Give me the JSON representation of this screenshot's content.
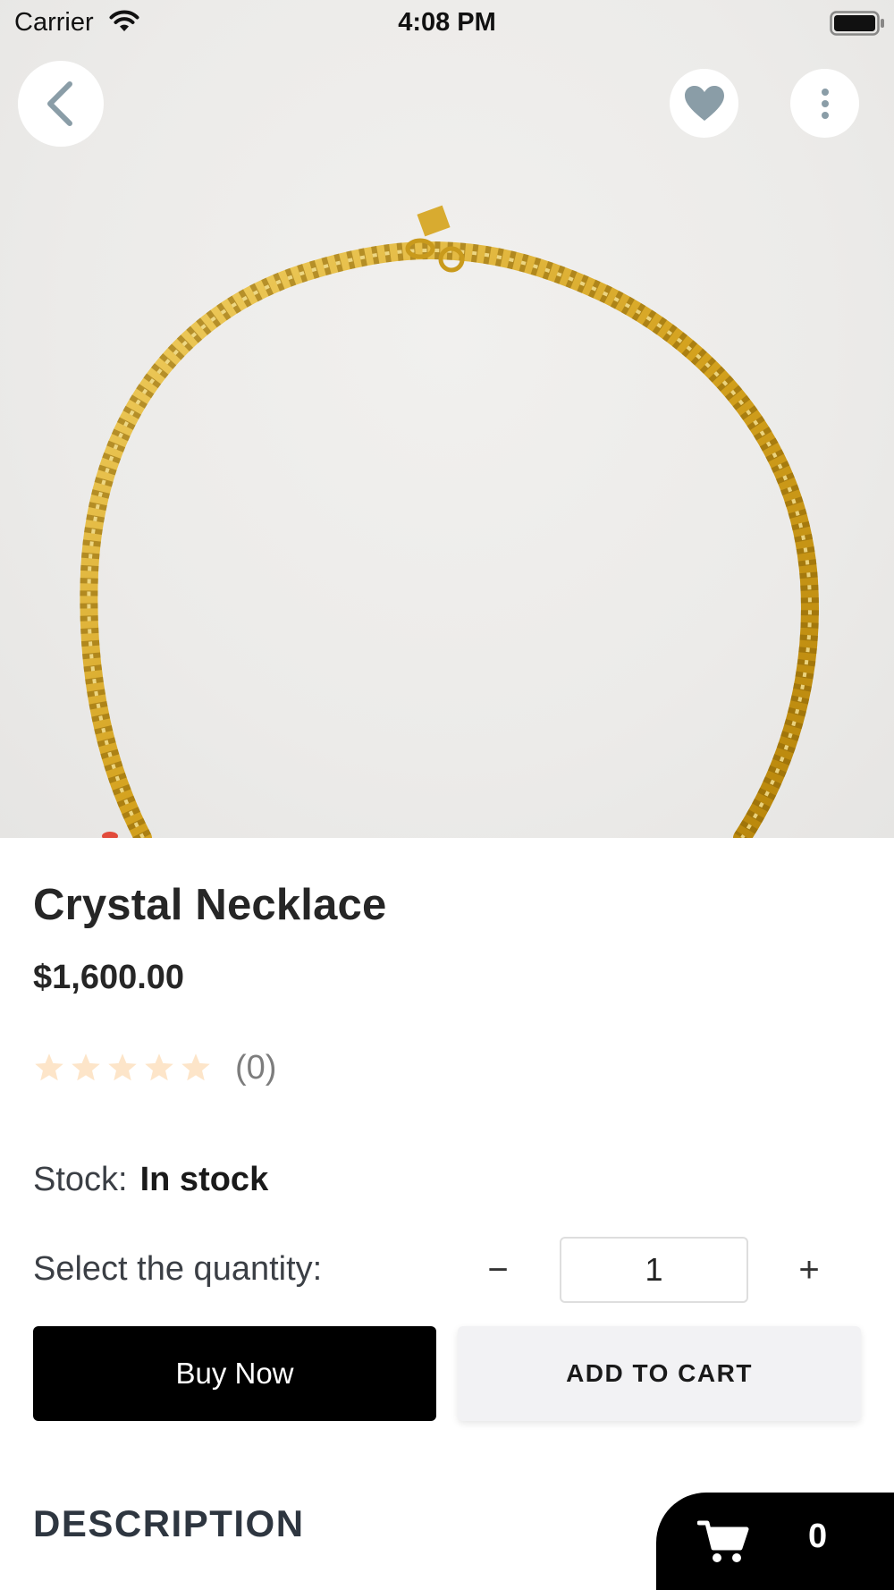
{
  "status_bar": {
    "carrier": "Carrier",
    "time": "4:08 PM"
  },
  "icons": {
    "back": "chevron-left-icon",
    "favorite": "heart-icon",
    "more": "more-vertical-icon",
    "cart": "cart-icon",
    "wifi": "wifi-icon",
    "battery": "battery-icon"
  },
  "colors": {
    "icon_gray": "#8a9da7",
    "star_empty": "#fde5c9",
    "primary_button": "#000000",
    "secondary_button": "#f2f2f4"
  },
  "product": {
    "title": "Crystal Necklace",
    "price": "$1,600.00",
    "rating": 0,
    "rating_max": 5,
    "rating_count": "(0)",
    "stock_label": "Stock:",
    "stock_value": "In stock"
  },
  "quantity": {
    "label": "Select the quantity:",
    "minus": "−",
    "value": "1",
    "plus": "+"
  },
  "actions": {
    "buy_now": "Buy Now",
    "add_to_cart": "ADD TO CART"
  },
  "description": {
    "heading": "DESCRIPTION"
  },
  "cart": {
    "count": "0"
  }
}
